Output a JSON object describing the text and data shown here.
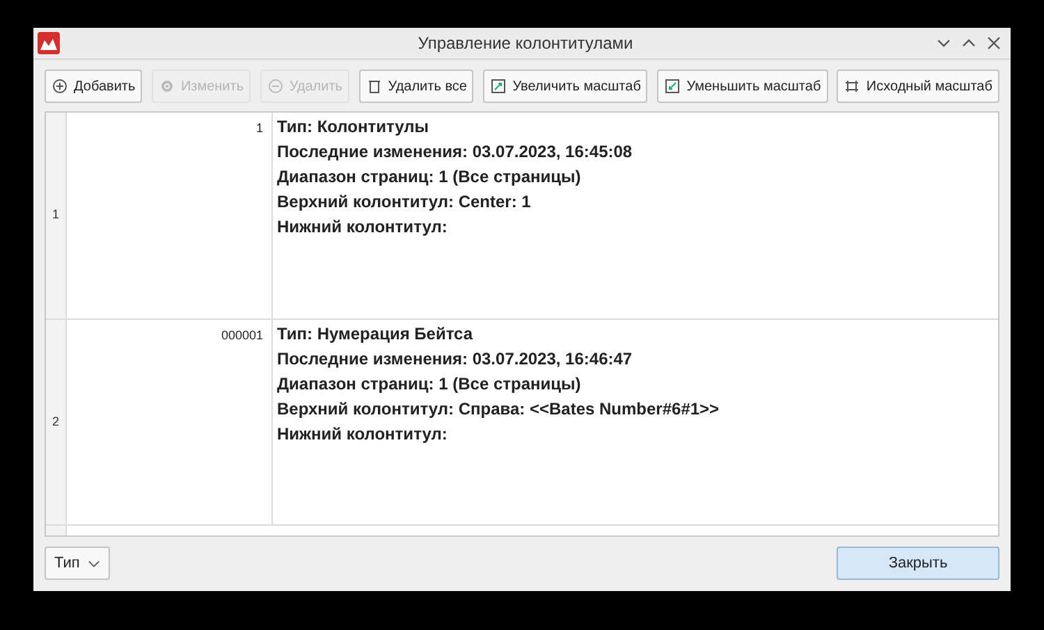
{
  "window": {
    "title": "Управление колонтитулами"
  },
  "toolbar": [
    {
      "kind": "add",
      "label": "Добавить",
      "disabled": false
    },
    {
      "kind": "edit",
      "label": "Изменить",
      "disabled": true
    },
    {
      "kind": "remove",
      "label": "Удалить",
      "disabled": true
    },
    {
      "kind": "clear",
      "label": "Удалить все",
      "disabled": false
    },
    {
      "kind": "zoom_in",
      "label": "Увеличить масштаб",
      "disabled": false
    },
    {
      "kind": "zoom_out",
      "label": "Уменьшить масштаб",
      "disabled": false
    },
    {
      "kind": "reset",
      "label": "Исходный масштаб",
      "disabled": false
    }
  ],
  "rows": [
    {
      "header": "1",
      "number": "1",
      "lines": [
        "Тип: Колонтитулы",
        "Последние изменения: 03.07.2023, 16:45:08",
        "Диапазон страниц: 1 (Все страницы)",
        "Верхний колонтитул: Center: 1",
        "Нижний колонтитул:"
      ]
    },
    {
      "header": "2",
      "number": "000001",
      "lines": [
        "Тип: Нумерация Бейтса",
        "Последние изменения: 03.07.2023, 16:46:47",
        "Диапазон страниц: 1 (Все страницы)",
        "Верхний колонтитул: Справа: <<Bates Number#6#1>>",
        "Нижний колонтитул:"
      ]
    }
  ],
  "type_dropdown": {
    "value": "Тип"
  },
  "close_button": {
    "label": "Закрыть"
  }
}
